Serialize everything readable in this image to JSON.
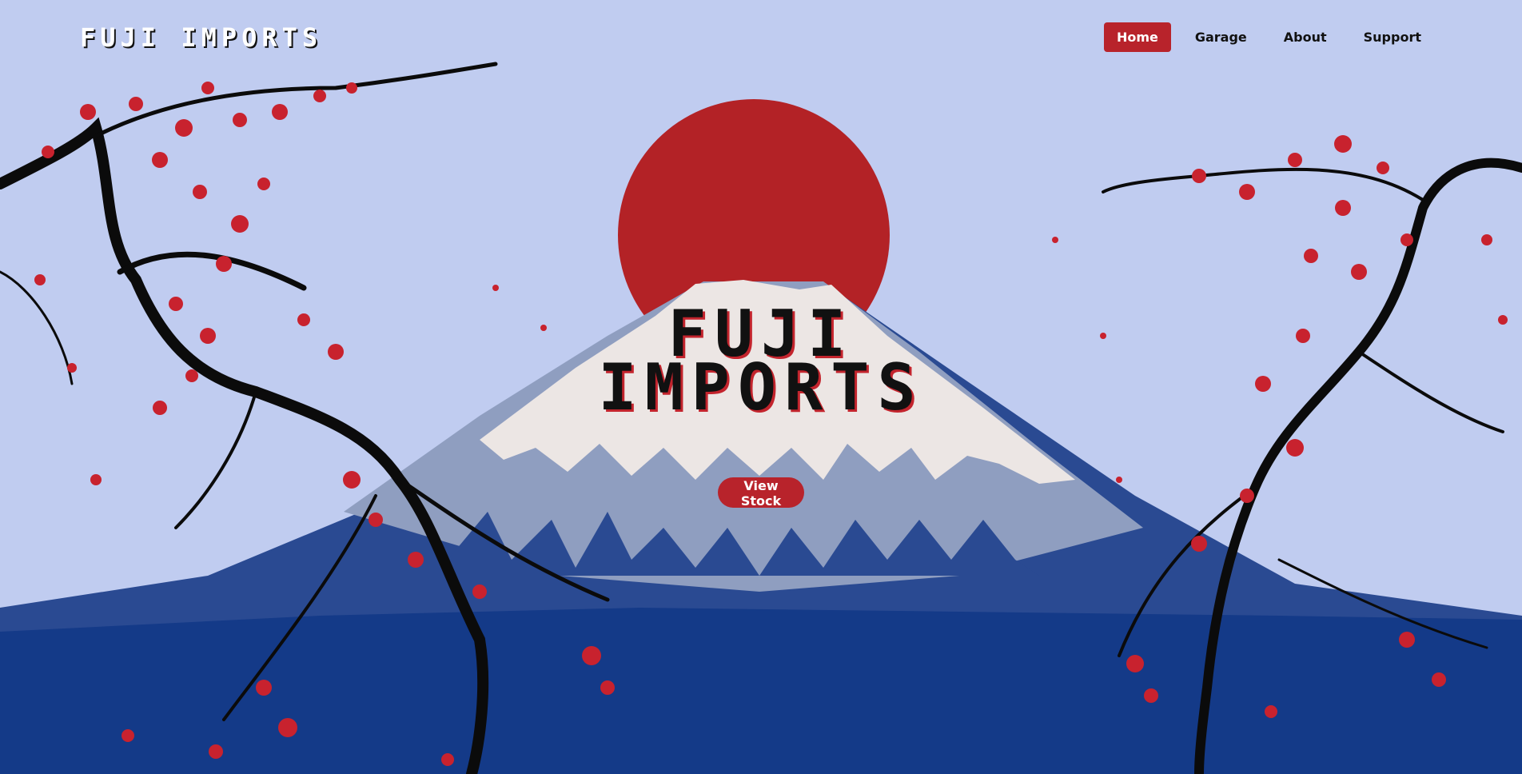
{
  "nav": {
    "logo": "FUJI IMPORTS",
    "items": [
      {
        "label": "Home",
        "active": true
      },
      {
        "label": "Garage",
        "active": false
      },
      {
        "label": "About",
        "active": false
      },
      {
        "label": "Support",
        "active": false
      }
    ]
  },
  "hero": {
    "title_line1": "FUJI",
    "title_line2": "IMPORTS",
    "cta_label": "View Stock"
  },
  "colors": {
    "sky": "#c0ccf0",
    "sun": "#b32226",
    "accent": "#b8232b",
    "mountain": "#2a4a92",
    "ground": "#143a88",
    "snow": "#ece6e4",
    "blossom": "#c8222e"
  },
  "icons": [
    "mount-fuji-illustration",
    "rising-sun",
    "cherry-blossom-branch-left",
    "cherry-blossom-branch-right"
  ]
}
